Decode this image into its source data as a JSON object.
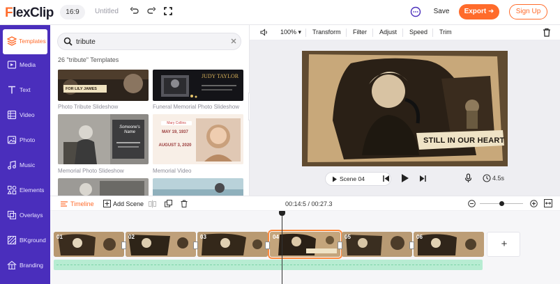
{
  "app": {
    "logo_prefix": "F",
    "logo_rest": "lexClip",
    "aspect_ratio": "16:9",
    "project_title": "Untitled",
    "save_label": "Save",
    "export_label": "Export ➜",
    "signup_label": "Sign Up",
    "brand_color": "#ff6b2b",
    "sidebar_color": "#4a2ebc"
  },
  "sidebar": {
    "items": [
      {
        "label": "Templates",
        "icon": "layers-icon",
        "active": true
      },
      {
        "label": "Media",
        "icon": "media-icon"
      },
      {
        "label": "Text",
        "icon": "text-icon"
      },
      {
        "label": "Video",
        "icon": "video-icon"
      },
      {
        "label": "Photo",
        "icon": "photo-icon"
      },
      {
        "label": "Music",
        "icon": "music-icon"
      },
      {
        "label": "Elements",
        "icon": "elements-icon"
      },
      {
        "label": "Overlays",
        "icon": "overlays-icon"
      },
      {
        "label": "BKground",
        "icon": "background-icon"
      },
      {
        "label": "Branding",
        "icon": "branding-icon"
      }
    ]
  },
  "templates": {
    "search_value": "tribute",
    "result_count": "26 \"tribute\" Templates",
    "items": [
      {
        "caption": "Photo Tribute Slideshow",
        "thumb_text": "FOR LILY JAMES"
      },
      {
        "caption": "Funeral Memorial Photo Slideshow",
        "thumb_text": "JUDY TAYLOR"
      },
      {
        "caption": "Memorial Photo Slideshow",
        "thumb_text": "Someone's Name"
      },
      {
        "caption": "Memorial Video",
        "thumb_name": "Mary Collins",
        "thumb_date1": "MAY 19, 1937",
        "thumb_date2": "AUGUST 3, 2020"
      }
    ]
  },
  "editor": {
    "zoom": "100%",
    "tools": [
      "Transform",
      "Filter",
      "Adjust",
      "Speed",
      "Trim"
    ],
    "overlay_text": "STILL IN OUR HEART",
    "scene_label": "Scene 04",
    "duration": "4.5s"
  },
  "timeline": {
    "timeline_label": "Timeline",
    "add_scene_label": "Add Scene",
    "time": "00:14:5 / 00:27.3",
    "zoom_level": 0.5,
    "clips": [
      "01",
      "02",
      "03",
      "04",
      "05",
      "06"
    ],
    "selected_clip": "04",
    "add_clip_label": "+"
  }
}
